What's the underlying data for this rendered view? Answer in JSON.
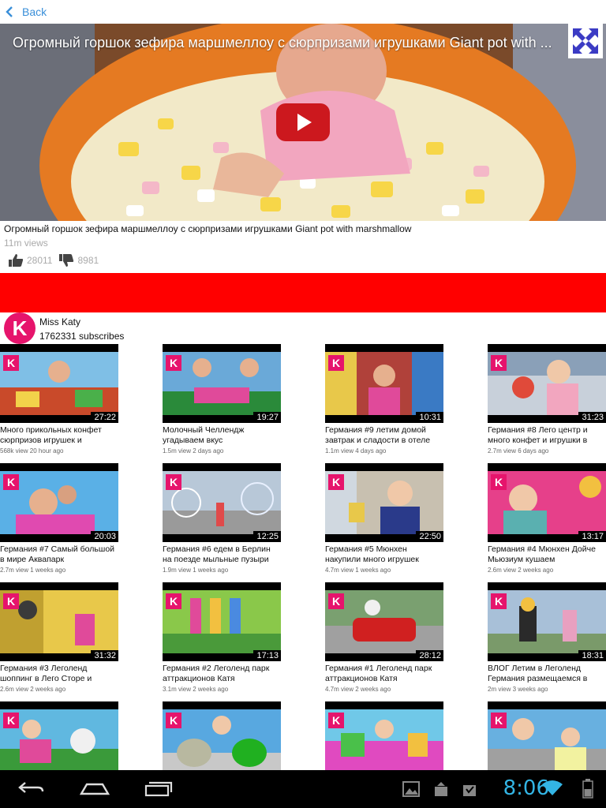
{
  "topbar": {
    "back_label": "Back"
  },
  "player": {
    "overlay_title": "Огромный горшок зефира маршмеллоу с сюрпризами игрушками Giant pot with ..."
  },
  "video": {
    "title": "Огромный горшок зефира маршмеллоу с сюрпризами игрушками Giant pot with marshmallow",
    "views": "11m views",
    "likes": "28011",
    "dislikes": "8981"
  },
  "channel": {
    "name": "Miss Katy",
    "subscribers": "1762331 subscribes"
  },
  "grid": {
    "videos": [
      {
        "title": "Много прикольных конфет сюрпризов игрушек и",
        "meta": "568k view 20 hour ago",
        "duration": "27:22"
      },
      {
        "title": "Молочный Челлендж угадываем вкус",
        "meta": "1.5m view 2 days ago",
        "duration": "19:27"
      },
      {
        "title": "Германия #9 летим домой завтрак и сладости в отеле",
        "meta": "1.1m view 4 days ago",
        "duration": "10:31"
      },
      {
        "title": "Германия #8 Лего центр и много конфет и игрушки в",
        "meta": "2.7m view 6 days ago",
        "duration": "31:23"
      },
      {
        "title": "Германия #7 Самый большой в мире Аквапарк",
        "meta": "2.7m view 1 weeks ago",
        "duration": "20:03"
      },
      {
        "title": "Германия #6 едем в Берлин на поезде мыльные пузыри",
        "meta": "1.9m view 1 weeks ago",
        "duration": "12:25"
      },
      {
        "title": "Германия #5 Мюнхен накупили много игрушек",
        "meta": "4.7m view 1 weeks ago",
        "duration": "22:50"
      },
      {
        "title": "Германия #4 Мюнхен Дойче Мьюзиум кушаем",
        "meta": "2.6m view 2 weeks ago",
        "duration": "13:17"
      },
      {
        "title": "Германия #3 Леголенд шоппинг в Лего Сторе и",
        "meta": "2.6m view 2 weeks ago",
        "duration": "31:32"
      },
      {
        "title": "Германия #2 Леголенд парк аттракционов Катя",
        "meta": "3.1m view 2 weeks ago",
        "duration": "17:13"
      },
      {
        "title": "Германия #1 Леголенд парк аттракционов Катя",
        "meta": "4.7m view 2 weeks ago",
        "duration": "28:12"
      },
      {
        "title": "ВЛОГ Летим в Леголенд Германия размещаемся в",
        "meta": "2m view 3 weeks ago",
        "duration": "18:31"
      },
      {
        "title": "",
        "meta": "",
        "duration": ""
      },
      {
        "title": "",
        "meta": "",
        "duration": ""
      },
      {
        "title": "",
        "meta": "",
        "duration": ""
      },
      {
        "title": "",
        "meta": "",
        "duration": ""
      }
    ]
  },
  "statusbar": {
    "time": "8:06"
  },
  "colors": {
    "accent": "#33b5e5",
    "brand": "#e6146c",
    "play": "#cc181e",
    "band": "#ff0000"
  },
  "icons": [
    "back-chevron-icon",
    "fullscreen-icon",
    "play-icon",
    "thumbs-up-icon",
    "thumbs-down-icon",
    "nav-back-icon",
    "nav-home-icon",
    "nav-recents-icon",
    "gallery-icon",
    "upload-icon",
    "download-icon",
    "wifi-icon",
    "battery-icon"
  ]
}
